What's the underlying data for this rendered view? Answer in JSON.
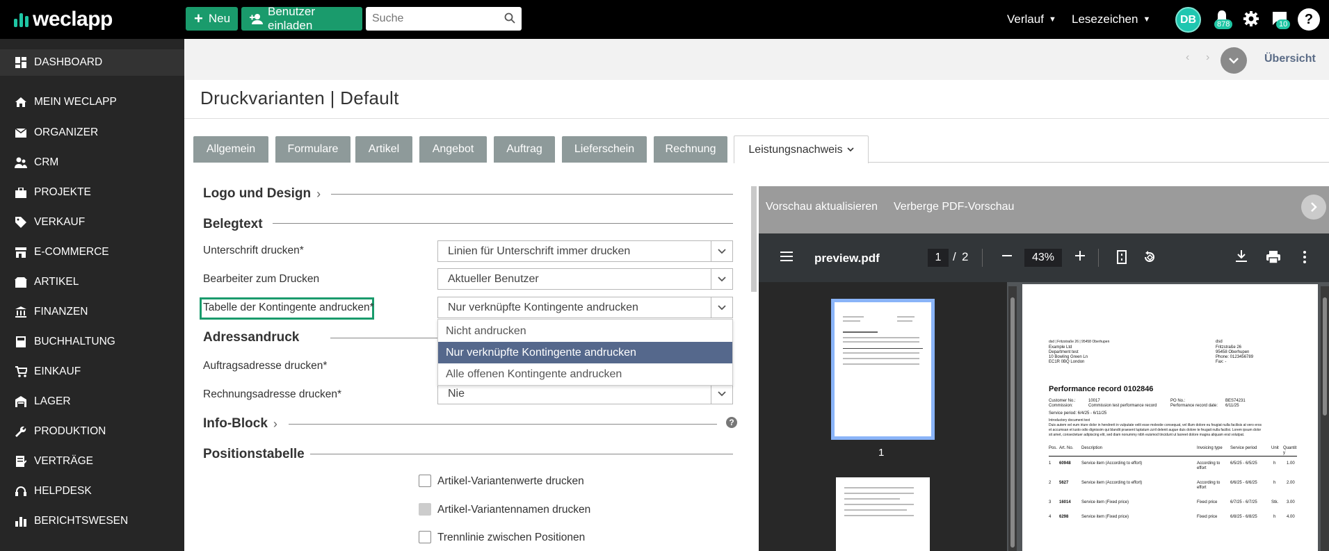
{
  "app": {
    "logo": "weclapp"
  },
  "topbar": {
    "new_label": "Neu",
    "invite_label": "Benutzer einladen",
    "search_placeholder": "Suche",
    "history_label": "Verlauf",
    "bookmarks_label": "Lesezeichen",
    "avatar_initials": "DB",
    "notifications_count": "878",
    "messages_count": "10",
    "help_label": "?"
  },
  "sidebar": {
    "items": [
      {
        "label": "DASHBOARD",
        "icon": "dashboard-icon"
      },
      {
        "label": "MEIN WECLAPP",
        "icon": "home-icon"
      },
      {
        "label": "ORGANIZER",
        "icon": "mail-icon"
      },
      {
        "label": "CRM",
        "icon": "people-icon"
      },
      {
        "label": "PROJEKTE",
        "icon": "briefcase-icon"
      },
      {
        "label": "VERKAUF",
        "icon": "tag-icon"
      },
      {
        "label": "E-COMMERCE",
        "icon": "shop-icon"
      },
      {
        "label": "ARTIKEL",
        "icon": "box-icon"
      },
      {
        "label": "FINANZEN",
        "icon": "bank-icon"
      },
      {
        "label": "BUCHHALTUNG",
        "icon": "calculator-icon"
      },
      {
        "label": "EINKAUF",
        "icon": "cart-icon"
      },
      {
        "label": "LAGER",
        "icon": "warehouse-icon"
      },
      {
        "label": "PRODUKTION",
        "icon": "wrench-icon"
      },
      {
        "label": "VERTRÄGE",
        "icon": "contract-icon"
      },
      {
        "label": "HELPDESK",
        "icon": "headset-icon"
      },
      {
        "label": "BERICHTSWESEN",
        "icon": "chart-icon"
      }
    ]
  },
  "subheader": {
    "overview_label": "Übersicht"
  },
  "page": {
    "title": "Druckvarianten | Default"
  },
  "tabs": [
    {
      "label": "Allgemein"
    },
    {
      "label": "Formulare"
    },
    {
      "label": "Artikel"
    },
    {
      "label": "Angebot"
    },
    {
      "label": "Auftrag"
    },
    {
      "label": "Lieferschein"
    },
    {
      "label": "Rechnung"
    },
    {
      "label": "Leistungsnachweis"
    }
  ],
  "form": {
    "section_logo": "Logo und Design",
    "section_belegtext": "Belegtext",
    "label_signature": "Unterschrift drucken*",
    "value_signature": "Linien für Unterschrift immer drucken",
    "label_editor": "Bearbeiter zum Drucken",
    "value_editor": "Aktueller Benutzer",
    "label_quota": "Tabelle der Kontingente andrucken*",
    "value_quota": "Nur verknüpfte Kontingente andrucken",
    "dropdown_options": [
      "Nicht andrucken",
      "Nur verknüpfte Kontingente andrucken",
      "Alle offenen Kontingente andrucken"
    ],
    "section_address": "Adressandruck",
    "label_order_address": "Auftragsadresse drucken*",
    "label_invoice_address": "Rechnungsadresse drucken*",
    "value_invoice_address": "Nie",
    "section_info": "Info-Block",
    "section_positions": "Positionstabelle",
    "cb_variant_values": "Artikel-Variantenwerte drucken",
    "cb_variant_names": "Artikel-Variantennamen drucken",
    "cb_separator": "Trennlinie zwischen Positionen"
  },
  "preview": {
    "refresh_label": "Vorschau aktualisieren",
    "hide_label": "Verberge PDF-Vorschau",
    "file_name": "preview.pdf",
    "page_current": "1",
    "page_sep": "/",
    "page_total": "2",
    "zoom": "43%",
    "thumb_label": "1",
    "doc": {
      "sender_line": "dsd | Fritzstraße 26 | 95458 Oberhupen",
      "addr": [
        "Example Ltd",
        "Department test",
        "10 Bowling Green Ln",
        "EC1R 0BQ London"
      ],
      "company": [
        "dsd",
        "Fritzstraße 26",
        "95458 Oberhupen",
        "Phone: 0123456789",
        "Fax: -"
      ],
      "title": "Performance record 0102846",
      "meta_left": [
        "Customer No.:",
        "Commission:"
      ],
      "meta_left_val": [
        "10017",
        "Commission test performance record"
      ],
      "meta_right": [
        "PO No.:",
        "Performance record date:"
      ],
      "meta_right_val": [
        "BES74231",
        "6/11/25"
      ],
      "service_period": "Service period: 6/4/25 - 6/11/25",
      "intro": [
        "Introductory document text",
        "Duis autem vel eum iriure dolor in hendrerit in vulputate velit esse molestie consequat, vel illum dolore eu feugiat nulla facilisis at vero eros",
        "et accumsan et iusto odio dignissim qui blandit praesent luptatum zzril delenit augue duis dolore te feugait nulla facilisi. Lorem ipsum dolor",
        "sit amet, consectetuer adipiscing elit, sed diam nonummy nibh euismod tincidunt ut laoreet dolore magna aliquam erat volutpat."
      ],
      "columns": [
        "Pos.",
        "Art. No.",
        "Description",
        "Invoicing type",
        "Service period",
        "Unit",
        "Quantit y"
      ],
      "rows": [
        [
          "1",
          "60948",
          "Service item (According to effort)",
          "According to effort",
          "6/5/25 - 6/5/25",
          "h",
          "1.00"
        ],
        [
          "2",
          "5627",
          "Service item (According to effort)",
          "According to effort",
          "6/6/25 - 6/6/25",
          "h",
          "2.00"
        ],
        [
          "3",
          "16014",
          "Service item (Fixed price)",
          "Fixed price",
          "6/7/25 - 6/7/25",
          "Stk.",
          "3.00"
        ],
        [
          "4",
          "6298",
          "Service item (Fixed price)",
          "Fixed price",
          "6/8/25 - 6/8/25",
          "h",
          "4.00"
        ]
      ]
    }
  },
  "colors": {
    "accent": "#1a9b6c",
    "selected_option": "#55688c",
    "sidebar_bg": "#262626"
  }
}
